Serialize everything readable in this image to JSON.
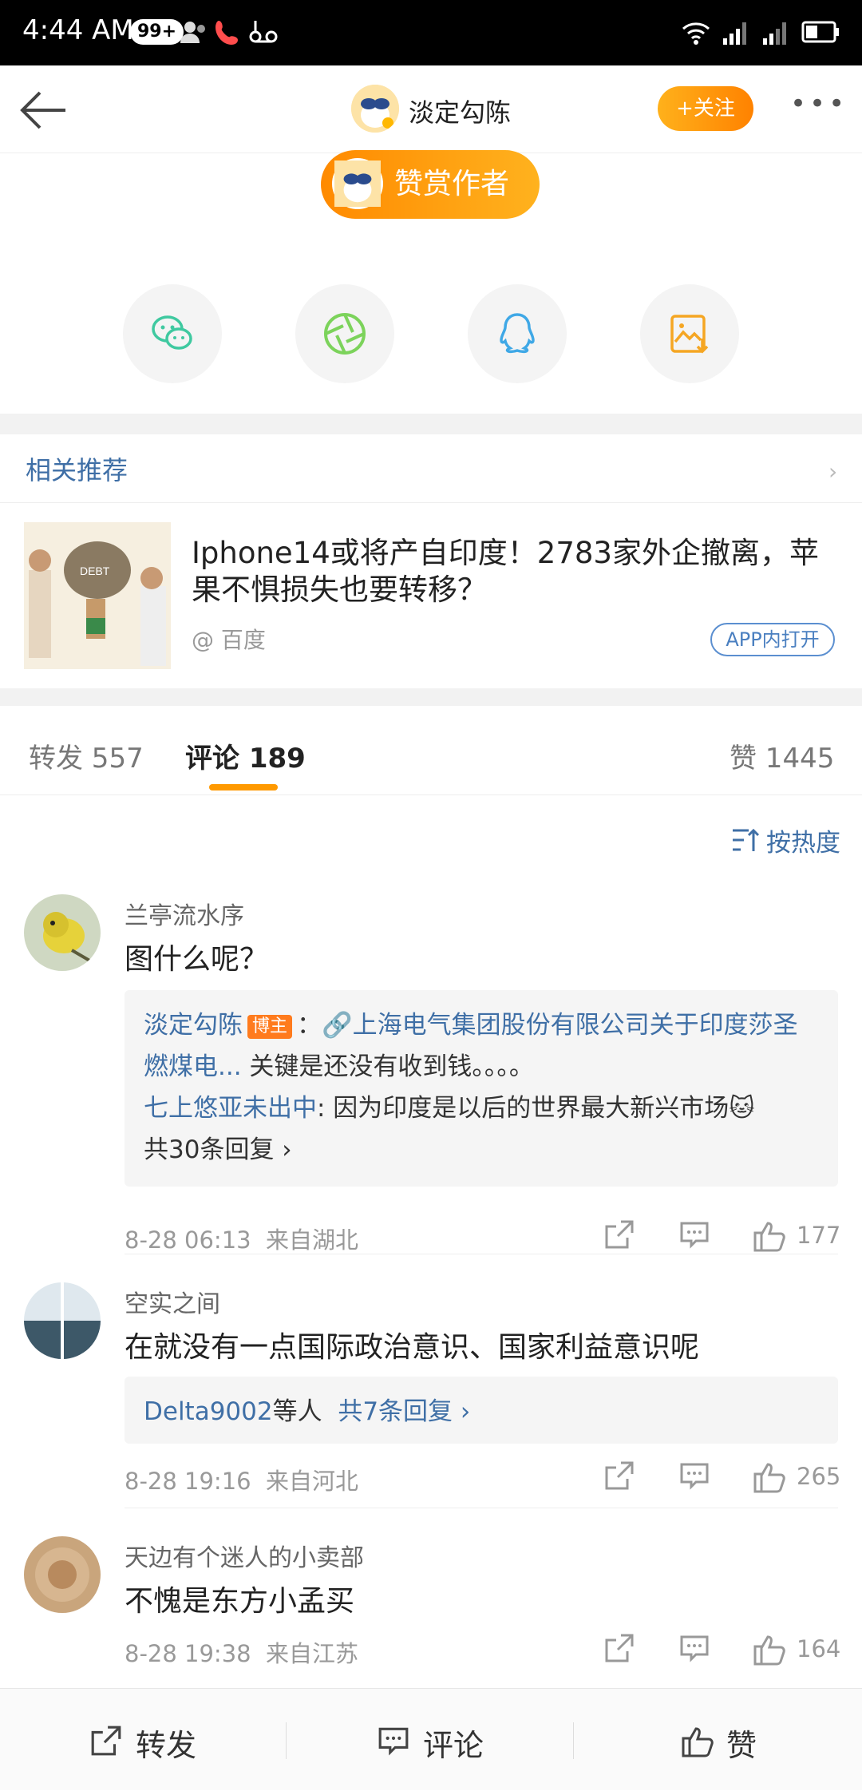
{
  "status_bar": {
    "time": "4:44 AM",
    "notif_badge": "99+"
  },
  "header": {
    "author_name": "淡定勾陈",
    "follow_label": "+关注",
    "more_label": "•••"
  },
  "reward": {
    "label": "赞赏作者"
  },
  "share_icons": [
    "wechat-icon",
    "moments-icon",
    "qq-icon",
    "save-image-icon"
  ],
  "recommend": {
    "heading": "相关推荐",
    "item": {
      "title": "Iphone14或将产自印度！2783家外企撤离，苹果不惧损失也要转移？",
      "source": "@ 百度",
      "open_app": "APP内打开"
    }
  },
  "tabs": {
    "repost": "转发 557",
    "comment": "评论 189",
    "like": "赞 1445"
  },
  "sort": {
    "label": "按热度"
  },
  "comments": [
    {
      "user": "兰亭流水序",
      "text": "图什么呢？",
      "replies": {
        "r1_user": "淡定勾陈",
        "r1_tag": "博主",
        "r1_sep": "：",
        "r1_link": "上海电气集团股份有限公司关于印度莎圣燃煤电...",
        "r1_text": " 关键是还没有收到钱。。。。",
        "r2_user": "七上悠亚未出中",
        "r2_text": ": 因为印度是以后的世界最大新兴市场",
        "more": "共30条回复 ›"
      },
      "time": "8-28 06:13",
      "location": "来自湖北",
      "likes": "177"
    },
    {
      "user": "空实之间",
      "text": "在就没有一点国际政治意识、国家利益意识呢",
      "replies": {
        "summary_user": "Delta9002",
        "summary_suffix": "等人",
        "more": "共7条回复 ›"
      },
      "time": "8-28 19:16",
      "location": "来自河北",
      "likes": "265"
    },
    {
      "user": "天边有个迷人的小卖部",
      "text": "不愧是东方小孟买",
      "time": "8-28 19:38",
      "location": "来自江苏",
      "likes": "164"
    }
  ],
  "bottom_bar": {
    "repost": "转发",
    "comment": "评论",
    "like": "赞"
  },
  "colors": {
    "accent": "#ff9900",
    "link": "#3f6fa6",
    "blogger_tag": "#ff7b1d"
  }
}
